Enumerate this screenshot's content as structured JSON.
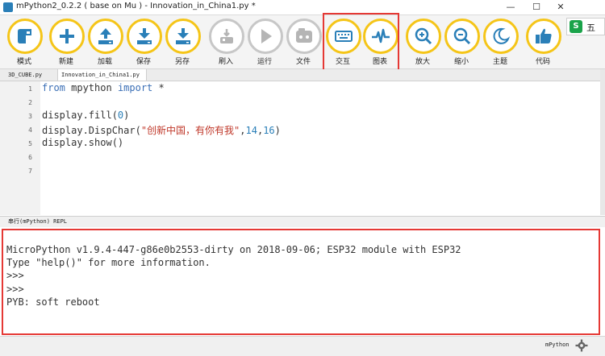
{
  "window": {
    "title": "mPython2_0.2.2 ( base on Mu ) - Innovation_in_China1.py *",
    "minimize": "—",
    "maximize": "☐",
    "close": "✕"
  },
  "ime": {
    "logo": "S",
    "label": "五"
  },
  "toolbar": {
    "buttons": [
      {
        "id": "mode",
        "label": "模式",
        "icon": "mode-icon",
        "enabled": true
      },
      {
        "id": "new",
        "label": "新建",
        "icon": "plus-icon",
        "enabled": true
      },
      {
        "id": "load",
        "label": "加载",
        "icon": "upload-icon",
        "enabled": true
      },
      {
        "id": "save",
        "label": "保存",
        "icon": "download-icon",
        "enabled": true
      },
      {
        "id": "saveas",
        "label": "另存",
        "icon": "download-icon",
        "enabled": true
      },
      {
        "id": "flash",
        "label": "刷入",
        "icon": "flash-icon",
        "enabled": false
      },
      {
        "id": "run",
        "label": "运行",
        "icon": "play-icon",
        "enabled": false
      },
      {
        "id": "files",
        "label": "文件",
        "icon": "files-icon",
        "enabled": false
      },
      {
        "id": "repl",
        "label": "交互",
        "icon": "keyboard-icon",
        "enabled": true
      },
      {
        "id": "plot",
        "label": "图表",
        "icon": "pulse-icon",
        "enabled": true
      },
      {
        "id": "zoomin",
        "label": "放大",
        "icon": "zoom-in-icon",
        "enabled": true
      },
      {
        "id": "zoomout",
        "label": "缩小",
        "icon": "zoom-out-icon",
        "enabled": true
      },
      {
        "id": "theme",
        "label": "主题",
        "icon": "moon-icon",
        "enabled": true
      },
      {
        "id": "code",
        "label": "代码",
        "icon": "thumbs-up-icon",
        "enabled": true
      }
    ]
  },
  "tabs": [
    {
      "label": "3D_CUBE.py",
      "active": false
    },
    {
      "label": "Innovation_in_China1.py *",
      "active": true
    }
  ],
  "editor": {
    "line_numbers": [
      "1",
      "2",
      "3",
      "4",
      "5",
      "6",
      "7"
    ],
    "lines": [
      {
        "kw1": "from",
        "mid": " mpython ",
        "kw2": "import",
        "rest": " *"
      },
      {
        "text": ""
      },
      {
        "pre": "display.fill(",
        "num": "0",
        "post": ")"
      },
      {
        "pre": "display.DispChar(",
        "str": "\"创新中国，有你有我\"",
        "mid": ",",
        "num1": "14",
        "comma": ",",
        "num2": "16",
        "post": ")"
      },
      {
        "text": "display.show()"
      },
      {
        "text": ""
      },
      {
        "text": ""
      }
    ]
  },
  "repl": {
    "title": "串行(mPython) REPL",
    "lines": [
      "MicroPython v1.9.4-447-g86e0b2553-dirty on 2018-09-06; ESP32 module with ESP32",
      "Type \"help()\" for more information.",
      ">>>",
      ">>>",
      "PYB: soft reboot"
    ]
  },
  "status": {
    "mode": "mPython"
  },
  "colors": {
    "accent": "#f5c518",
    "highlight": "#e53935",
    "icon": "#2a7fb8"
  }
}
